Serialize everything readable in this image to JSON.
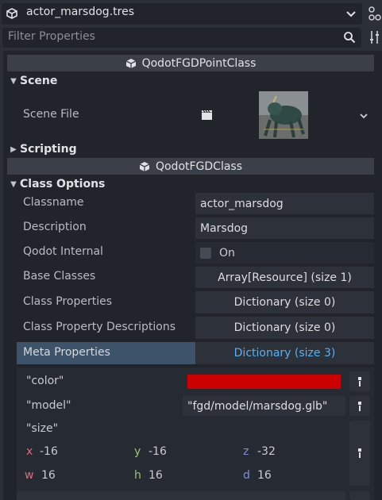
{
  "resource": {
    "name": "actor_marsdog.tres"
  },
  "filter": {
    "placeholder": "Filter Properties"
  },
  "point_class": {
    "title": "QodotFGDPointClass",
    "scene_section": "Scene",
    "scene_file_label": "Scene File",
    "scripting_section": "Scripting"
  },
  "fgd_class": {
    "title": "QodotFGDClass",
    "class_options_section": "Class Options",
    "rows": [
      {
        "label": "Classname",
        "value": "actor_marsdog"
      },
      {
        "label": "Description",
        "value": "Marsdog"
      },
      {
        "label": "Qodot Internal",
        "value": "On"
      },
      {
        "label": "Base Classes",
        "value": "Array[Resource] (size 1)"
      },
      {
        "label": "Class Properties",
        "value": "Dictionary (size 0)"
      },
      {
        "label": "Class Property Descriptions",
        "value": "Dictionary (size 0)"
      },
      {
        "label": "Meta Properties",
        "value": "Dictionary (size 3)"
      }
    ]
  },
  "meta": {
    "color_key": "\"color\"",
    "color_value": "#cc0000",
    "model_key": "\"model\"",
    "model_value": "\"fgd/model/marsdog.glb\"",
    "size_key": "\"size\"",
    "size": {
      "x_label": "x",
      "x": "-16",
      "y_label": "y",
      "y": "-16",
      "z_label": "z",
      "z": "-32",
      "w_label": "w",
      "w": "16",
      "h_label": "h",
      "h": "16",
      "d_label": "d",
      "d": "16"
    }
  },
  "colors": {
    "x_axis": "#e06c75",
    "y_axis": "#98c379",
    "z_axis": "#7f8cdb",
    "selected_row": "#3d5369",
    "link_value": "#5ab0f0"
  }
}
